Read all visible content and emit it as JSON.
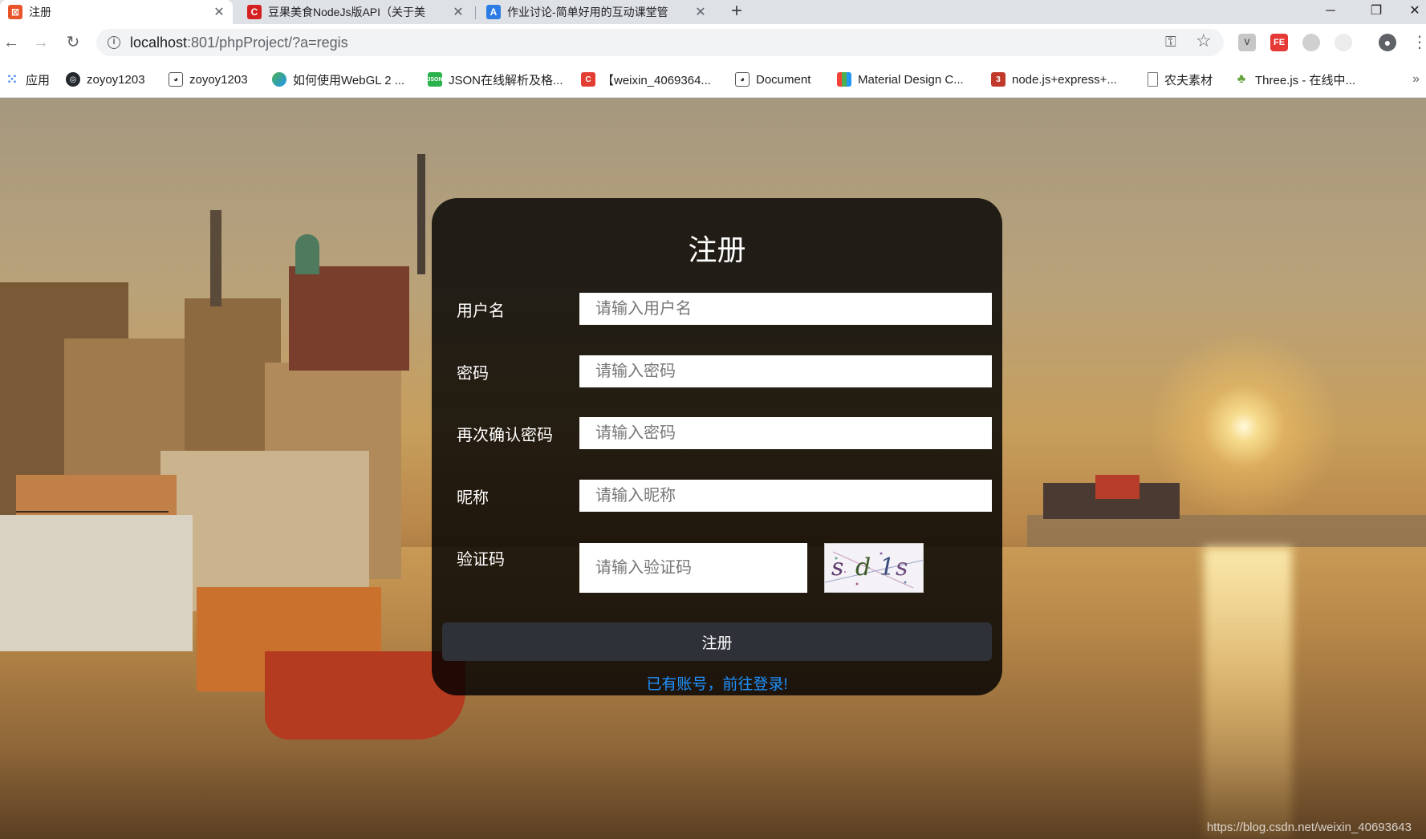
{
  "browser": {
    "tabs": [
      {
        "title": "注册",
        "favicon_color": "#e8542a",
        "favicon_glyph": "⊠"
      },
      {
        "title": "豆果美食NodeJs版API（关于美",
        "favicon_color": "#d32121",
        "favicon_glyph": "C"
      },
      {
        "title": "作业讨论-简单好用的互动课堂管",
        "favicon_color": "#2d7be5",
        "favicon_glyph": "A"
      }
    ],
    "new_tab": "+",
    "window_controls": {
      "minimize": "─",
      "restore": "❐",
      "close": "✕"
    },
    "tab_close": "✕"
  },
  "toolbar": {
    "back": "←",
    "forward": "→",
    "reload": "↻",
    "url_host": "localhost",
    "url_path": ":801/phpProject/?a=regis",
    "info_icon": "i",
    "key_icon": "⚿",
    "star_icon": "☆",
    "profile_icon": "●",
    "menu_icon": "⋮"
  },
  "bookmarks": [
    {
      "label": "应用",
      "icon": "apps-grid-icon",
      "color": "#4285f4"
    },
    {
      "label": "zoyoy1203",
      "icon": "github-icon",
      "color": "#24292e"
    },
    {
      "label": "zoyoy1203",
      "icon": "panda-icon",
      "color": "#555555"
    },
    {
      "label": "如何使用WebGL 2 ...",
      "icon": "webgl-icon",
      "color": "#4caf50"
    },
    {
      "label": "JSON在线解析及格...",
      "icon": "json-icon",
      "color": "#2bb24c"
    },
    {
      "label": "【weixin_4069364...",
      "icon": "csdn-icon",
      "color": "#e33e33"
    },
    {
      "label": "Document",
      "icon": "panda-icon",
      "color": "#555555"
    },
    {
      "label": "Material Design C...",
      "icon": "material-icon",
      "color": "#f4511e"
    },
    {
      "label": "node.js+express+...",
      "icon": "node-icon",
      "color": "#c0392b"
    },
    {
      "label": "农夫素材",
      "icon": "page-icon",
      "color": "#9e9e9e"
    },
    {
      "label": "Three.js - 在线中...",
      "icon": "threejs-icon",
      "color": "#66a13a"
    }
  ],
  "bookmarks_more": "»",
  "form": {
    "title": "注册",
    "username_label": "用户名",
    "username_placeholder": "请输入用户名",
    "password_label": "密码",
    "password_placeholder": "请输入密码",
    "confirm_label": "再次确认密码",
    "confirm_placeholder": "请输入密码",
    "nickname_label": "昵称",
    "nickname_placeholder": "请输入昵称",
    "captcha_label": "验证码",
    "captcha_placeholder": "请输入验证码",
    "captcha_text": [
      "s",
      "d",
      "1",
      "s"
    ],
    "submit_label": "注册",
    "login_link": "已有账号，前往登录!"
  },
  "watermark": "https://blog.csdn.net/weixin_40693643"
}
